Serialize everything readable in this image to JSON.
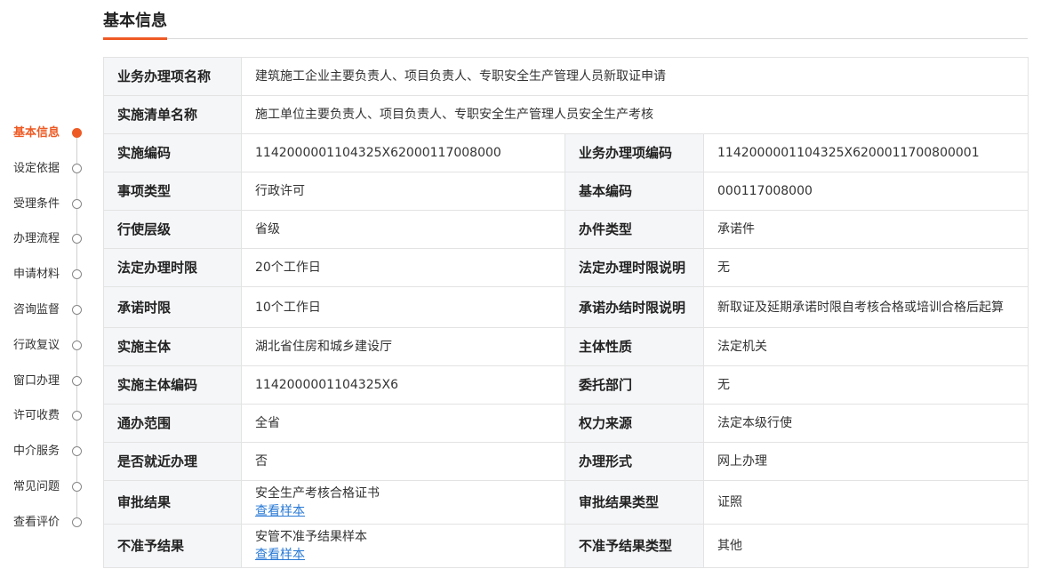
{
  "header": {
    "title": "基本信息"
  },
  "sidebar": {
    "items": [
      {
        "label": "基本信息",
        "active": true
      },
      {
        "label": "设定依据",
        "active": false
      },
      {
        "label": "受理条件",
        "active": false
      },
      {
        "label": "办理流程",
        "active": false
      },
      {
        "label": "申请材料",
        "active": false
      },
      {
        "label": "咨询监督",
        "active": false
      },
      {
        "label": "行政复议",
        "active": false
      },
      {
        "label": "窗口办理",
        "active": false
      },
      {
        "label": "许可收费",
        "active": false
      },
      {
        "label": "中介服务",
        "active": false
      },
      {
        "label": "常见问题",
        "active": false
      },
      {
        "label": "查看评价",
        "active": false
      }
    ]
  },
  "table": {
    "business_item_name": {
      "label": "业务办理项名称",
      "value": "建筑施工企业主要负责人、项目负责人、专职安全生产管理人员新取证申请"
    },
    "list_name": {
      "label": "实施清单名称",
      "value": "施工单位主要负责人、项目负责人、专职安全生产管理人员安全生产考核"
    },
    "rows": [
      {
        "l1": "实施编码",
        "v1": "1142000001104325X62000117008000",
        "l2": "业务办理项编码",
        "v2": "1142000001104325X6200011700800001"
      },
      {
        "l1": "事项类型",
        "v1": "行政许可",
        "l2": "基本编码",
        "v2": "000117008000"
      },
      {
        "l1": "行使层级",
        "v1": "省级",
        "l2": "办件类型",
        "v2": "承诺件"
      },
      {
        "l1": "法定办理时限",
        "v1": "20个工作日",
        "l2": "法定办理时限说明",
        "v2": "无"
      },
      {
        "l1": "承诺时限",
        "v1": "10个工作日",
        "l2": "承诺办结时限说明",
        "v2": "新取证及延期承诺时限自考核合格或培训合格后起算"
      },
      {
        "l1": "实施主体",
        "v1": "湖北省住房和城乡建设厅",
        "l2": "主体性质",
        "v2": "法定机关"
      },
      {
        "l1": "实施主体编码",
        "v1": "1142000001104325X6",
        "l2": "委托部门",
        "v2": "无"
      },
      {
        "l1": "通办范围",
        "v1": "全省",
        "l2": "权力来源",
        "v2": "法定本级行使"
      },
      {
        "l1": "是否就近办理",
        "v1": "否",
        "l2": "办理形式",
        "v2": "网上办理"
      }
    ],
    "approval_result": {
      "label": "审批结果",
      "value": "安全生产考核合格证书",
      "link": "查看样本",
      "type_label": "审批结果类型",
      "type_value": "证照"
    },
    "reject_result": {
      "label": "不准予结果",
      "value": "安管不准予结果样本",
      "link": "查看样本",
      "type_label": "不准予结果类型",
      "type_value": "其他"
    }
  },
  "colors": {
    "accent": "#ee5a24",
    "link": "#2a7ad6",
    "label_bg": "#f5f6f8",
    "border": "#e3e3e3"
  }
}
